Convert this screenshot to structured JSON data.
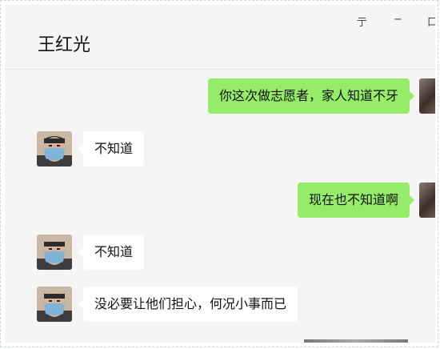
{
  "window": {
    "title": "王红光",
    "controls": {
      "pin": "亍",
      "minimize": "−",
      "maximize": "口"
    }
  },
  "messages": [
    {
      "side": "out",
      "text": "你这次做志愿者，家人知道不牙"
    },
    {
      "side": "in",
      "text": "不知道"
    },
    {
      "side": "out",
      "text": "现在也不知道啊"
    },
    {
      "side": "in",
      "text": "不知道"
    },
    {
      "side": "in",
      "text": "没必要让他们担心，何况小事而已"
    }
  ],
  "colors": {
    "outgoing_bubble": "#95ec69",
    "incoming_bubble": "#ffffff",
    "chat_background": "#f5f5f5"
  }
}
